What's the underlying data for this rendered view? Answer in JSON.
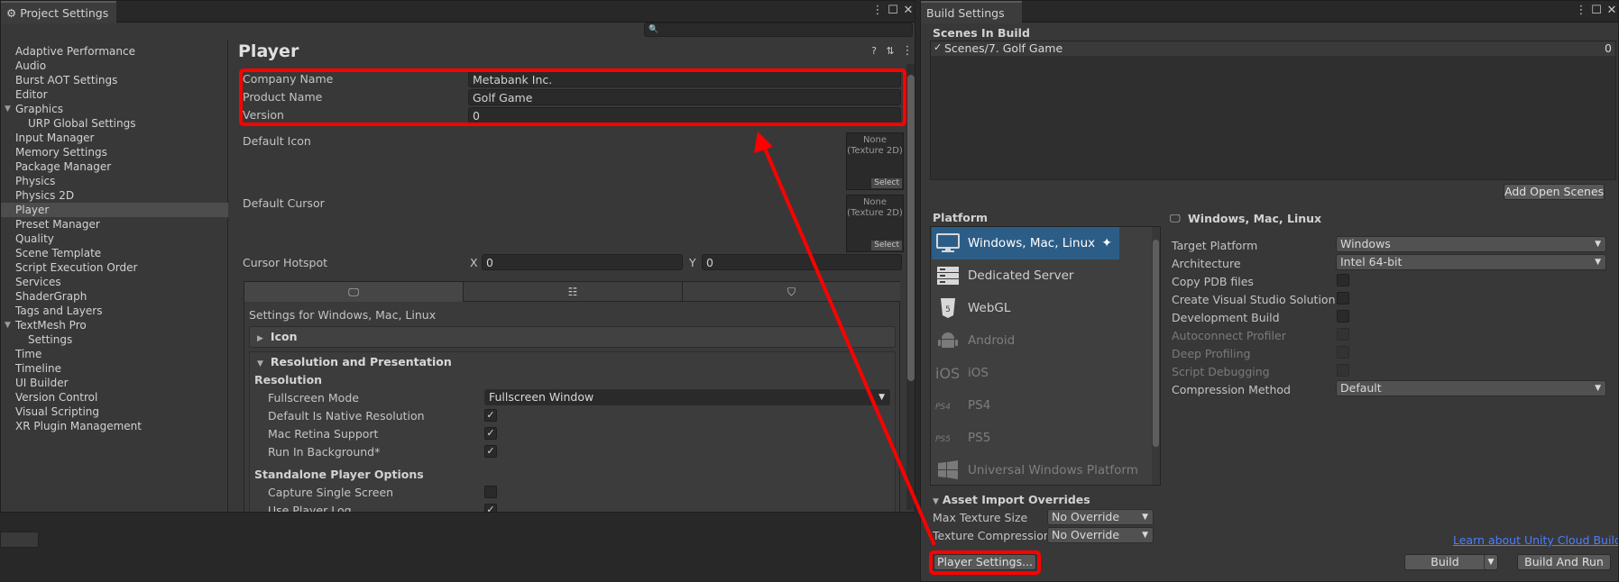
{
  "project_settings": {
    "tab_title": "Project Settings",
    "search_placeholder": "",
    "sidebar": [
      {
        "label": "Adaptive Performance",
        "indent": 0
      },
      {
        "label": "Audio",
        "indent": 0
      },
      {
        "label": "Burst AOT Settings",
        "indent": 0
      },
      {
        "label": "Editor",
        "indent": 0
      },
      {
        "label": "Graphics",
        "indent": 0,
        "expanded": true
      },
      {
        "label": "URP Global Settings",
        "indent": 1
      },
      {
        "label": "Input Manager",
        "indent": 0
      },
      {
        "label": "Memory Settings",
        "indent": 0
      },
      {
        "label": "Package Manager",
        "indent": 0
      },
      {
        "label": "Physics",
        "indent": 0
      },
      {
        "label": "Physics 2D",
        "indent": 0
      },
      {
        "label": "Player",
        "indent": 0,
        "selected": true
      },
      {
        "label": "Preset Manager",
        "indent": 0
      },
      {
        "label": "Quality",
        "indent": 0
      },
      {
        "label": "Scene Template",
        "indent": 0
      },
      {
        "label": "Script Execution Order",
        "indent": 0
      },
      {
        "label": "Services",
        "indent": 0
      },
      {
        "label": "ShaderGraph",
        "indent": 0
      },
      {
        "label": "Tags and Layers",
        "indent": 0
      },
      {
        "label": "TextMesh Pro",
        "indent": 0,
        "expanded": true
      },
      {
        "label": "Settings",
        "indent": 1
      },
      {
        "label": "Time",
        "indent": 0
      },
      {
        "label": "Timeline",
        "indent": 0
      },
      {
        "label": "UI Builder",
        "indent": 0
      },
      {
        "label": "Version Control",
        "indent": 0
      },
      {
        "label": "Visual Scripting",
        "indent": 0
      },
      {
        "label": "XR Plugin Management",
        "indent": 0
      }
    ],
    "player": {
      "title": "Player",
      "company_label": "Company Name",
      "company_value": "Metabank Inc.",
      "product_label": "Product Name",
      "product_value": "Golf Game",
      "version_label": "Version",
      "version_value": "0",
      "default_icon_label": "Default Icon",
      "default_cursor_label": "Default Cursor",
      "texture_none": "None\n(Texture 2D)",
      "select_label": "Select",
      "cursor_hotspot_label": "Cursor Hotspot",
      "hotspot_x_label": "X",
      "hotspot_x": "0",
      "hotspot_y_label": "Y",
      "hotspot_y": "0",
      "settings_for": "Settings for Windows, Mac, Linux",
      "icon_foldout": "Icon",
      "resolution_foldout": "Resolution and Presentation",
      "resolution_header": "Resolution",
      "fullscreen_mode_label": "Fullscreen Mode",
      "fullscreen_mode_value": "Fullscreen Window",
      "default_native_label": "Default Is Native Resolution",
      "default_native": true,
      "mac_retina_label": "Mac Retina Support",
      "mac_retina": true,
      "run_bg_label": "Run In Background*",
      "run_bg": true,
      "standalone_header": "Standalone Player Options",
      "capture_single_label": "Capture Single Screen",
      "capture_single": false,
      "use_player_log_label": "Use Player Log",
      "use_player_log": true
    }
  },
  "build_settings": {
    "tab_title": "Build Settings",
    "scenes_header": "Scenes In Build",
    "scenes": [
      {
        "name": "Scenes/7. Golf Game",
        "index": "0",
        "checked": true
      }
    ],
    "add_open_scenes": "Add Open Scenes",
    "platform_header": "Platform",
    "platforms": [
      {
        "name": "Windows, Mac, Linux",
        "icon": "monitor-icon",
        "state": "selected"
      },
      {
        "name": "Dedicated Server",
        "icon": "server-icon",
        "state": "enabled"
      },
      {
        "name": "WebGL",
        "icon": "html5-icon",
        "state": "enabled"
      },
      {
        "name": "Android",
        "icon": "android-icon",
        "state": "disabled"
      },
      {
        "name": "iOS",
        "icon": "ios-icon",
        "state": "disabled"
      },
      {
        "name": "PS4",
        "icon": "ps4-icon",
        "state": "disabled"
      },
      {
        "name": "PS5",
        "icon": "ps5-icon",
        "state": "disabled"
      },
      {
        "name": "Universal Windows Platform",
        "icon": "windows-icon",
        "state": "disabled"
      }
    ],
    "right_title": "Windows, Mac, Linux",
    "target_platform_label": "Target Platform",
    "target_platform": "Windows",
    "architecture_label": "Architecture",
    "architecture": "Intel 64-bit",
    "copy_pdb_label": "Copy PDB files",
    "create_vs_label": "Create Visual Studio Solution",
    "dev_build_label": "Development Build",
    "autoconnect_label": "Autoconnect Profiler",
    "deep_profiling_label": "Deep Profiling",
    "script_debugging_label": "Script Debugging",
    "compression_label": "Compression Method",
    "compression": "Default",
    "asset_overrides_header": "Asset Import Overrides",
    "max_texture_label": "Max Texture Size",
    "max_texture": "No Override",
    "texture_compression_label": "Texture Compression",
    "texture_compression": "No Override",
    "cloud_link": "Learn about Unity Cloud Build",
    "player_settings_btn": "Player Settings...",
    "build_btn": "Build",
    "build_and_run_btn": "Build And Run"
  },
  "colors": {
    "annotation": "#ff0000",
    "selection": "#2c5d87"
  }
}
